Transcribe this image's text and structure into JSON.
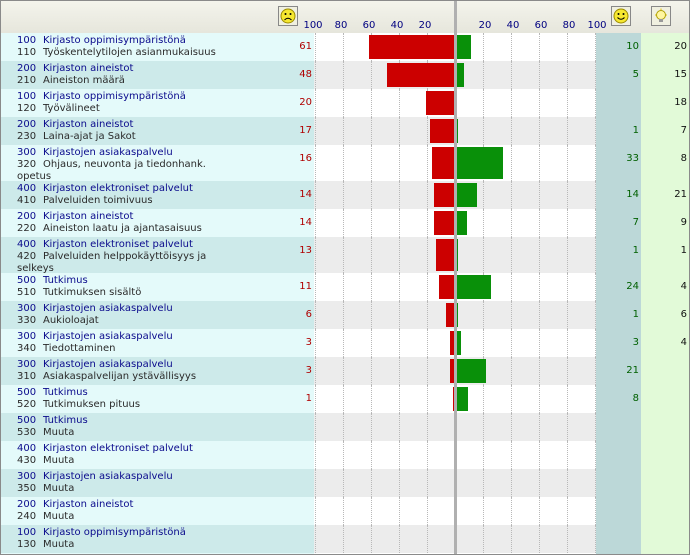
{
  "header": {
    "sad_icon": "sad-face-icon",
    "happy_icon": "happy-face-icon",
    "idea_icon": "lightbulb-icon",
    "neg_ticks": [
      "100",
      "80",
      "60",
      "40",
      "20"
    ],
    "pos_ticks": [
      "20",
      "40",
      "60",
      "80",
      "100"
    ]
  },
  "colors": {
    "negative": "#cc0000",
    "positive": "#099009"
  },
  "chart_data": {
    "type": "bar",
    "xlim": [
      -100,
      100
    ],
    "rows": [
      {
        "c1": "100",
        "t1": "Kirjasto oppimisympäristönä",
        "c2": "110",
        "t2": "Työskentelytilojen asianmukaisuus",
        "t3": "",
        "neg": 61,
        "pos": 10,
        "neg_label": "61",
        "pos_label": "10",
        "sug": "20"
      },
      {
        "c1": "200",
        "t1": "Kirjaston aineistot",
        "c2": "210",
        "t2": "Aineiston määrä",
        "t3": "",
        "neg": 48,
        "pos": 5,
        "neg_label": "48",
        "pos_label": "5",
        "sug": "15"
      },
      {
        "c1": "100",
        "t1": "Kirjasto oppimisympäristönä",
        "c2": "120",
        "t2": "Työvälineet",
        "t3": "",
        "neg": 20,
        "pos": 0,
        "neg_label": "20",
        "pos_label": "",
        "sug": "18"
      },
      {
        "c1": "200",
        "t1": "Kirjaston aineistot",
        "c2": "230",
        "t2": "Laina-ajat ja Sakot",
        "t3": "",
        "neg": 17,
        "pos": 1,
        "neg_label": "17",
        "pos_label": "1",
        "sug": "7"
      },
      {
        "c1": "300",
        "t1": "Kirjastojen asiakaspalvelu",
        "c2": "320",
        "t2": "Ohjaus, neuvonta ja tiedonhank.",
        "t3": "opetus",
        "neg": 16,
        "pos": 33,
        "neg_label": "16",
        "pos_label": "33",
        "sug": "8"
      },
      {
        "c1": "400",
        "t1": "Kirjaston elektroniset palvelut",
        "c2": "410",
        "t2": "Palveluiden toimivuus",
        "t3": "",
        "neg": 14,
        "pos": 14,
        "neg_label": "14",
        "pos_label": "14",
        "sug": "21"
      },
      {
        "c1": "200",
        "t1": "Kirjaston aineistot",
        "c2": "220",
        "t2": "Aineiston laatu ja ajantasaisuus",
        "t3": "",
        "neg": 14,
        "pos": 7,
        "neg_label": "14",
        "pos_label": "7",
        "sug": "9"
      },
      {
        "c1": "400",
        "t1": "Kirjaston elektroniset palvelut",
        "c2": "420",
        "t2": "Palveluiden helppokäyttöisyys ja",
        "t3": "selkeys",
        "neg": 13,
        "pos": 1,
        "neg_label": "13",
        "pos_label": "1",
        "sug": "1"
      },
      {
        "c1": "500",
        "t1": "Tutkimus",
        "c2": "510",
        "t2": "Tutkimuksen sisältö",
        "t3": "",
        "neg": 11,
        "pos": 24,
        "neg_label": "11",
        "pos_label": "24",
        "sug": "4"
      },
      {
        "c1": "300",
        "t1": "Kirjastojen asiakaspalvelu",
        "c2": "330",
        "t2": "Aukioloajat",
        "t3": "",
        "neg": 6,
        "pos": 1,
        "neg_label": "6",
        "pos_label": "1",
        "sug": "6"
      },
      {
        "c1": "300",
        "t1": "Kirjastojen asiakaspalvelu",
        "c2": "340",
        "t2": "Tiedottaminen",
        "t3": "",
        "neg": 3,
        "pos": 3,
        "neg_label": "3",
        "pos_label": "3",
        "sug": "4"
      },
      {
        "c1": "300",
        "t1": "Kirjastojen asiakaspalvelu",
        "c2": "310",
        "t2": "Asiakaspalvelijan ystävällisyys",
        "t3": "",
        "neg": 3,
        "pos": 21,
        "neg_label": "3",
        "pos_label": "21",
        "sug": ""
      },
      {
        "c1": "500",
        "t1": "Tutkimus",
        "c2": "520",
        "t2": "Tutkimuksen pituus",
        "t3": "",
        "neg": 1,
        "pos": 8,
        "neg_label": "1",
        "pos_label": "8",
        "sug": ""
      },
      {
        "c1": "500",
        "t1": "Tutkimus",
        "c2": "530",
        "t2": "Muuta",
        "t3": "",
        "neg": 0,
        "pos": 0,
        "neg_label": "",
        "pos_label": "",
        "sug": ""
      },
      {
        "c1": "400",
        "t1": "Kirjaston elektroniset palvelut",
        "c2": "430",
        "t2": "Muuta",
        "t3": "",
        "neg": 0,
        "pos": 0,
        "neg_label": "",
        "pos_label": "",
        "sug": ""
      },
      {
        "c1": "300",
        "t1": "Kirjastojen asiakaspalvelu",
        "c2": "350",
        "t2": "Muuta",
        "t3": "",
        "neg": 0,
        "pos": 0,
        "neg_label": "",
        "pos_label": "",
        "sug": ""
      },
      {
        "c1": "200",
        "t1": "Kirjaston aineistot",
        "c2": "240",
        "t2": "Muuta",
        "t3": "",
        "neg": 0,
        "pos": 0,
        "neg_label": "",
        "pos_label": "",
        "sug": ""
      },
      {
        "c1": "100",
        "t1": "Kirjasto oppimisympäristönä",
        "c2": "130",
        "t2": "Muuta",
        "t3": "",
        "neg": 0,
        "pos": 0,
        "neg_label": "",
        "pos_label": "",
        "sug": ""
      }
    ]
  }
}
